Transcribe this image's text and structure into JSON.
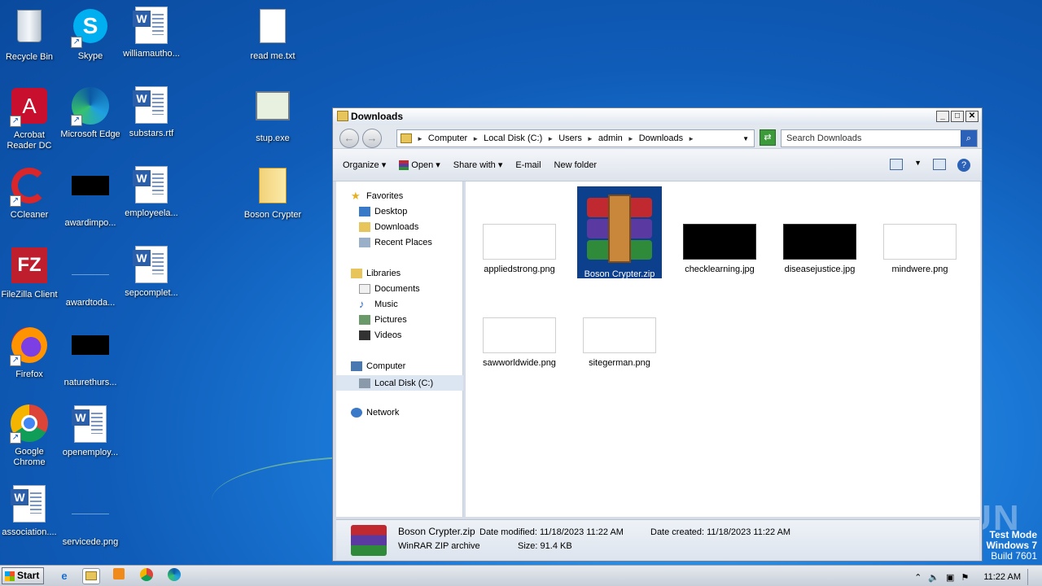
{
  "desktop": {
    "icons": [
      {
        "label": "Recycle Bin"
      },
      {
        "label": "Skype"
      },
      {
        "label": "williamautho..."
      },
      {
        "label": "read me.txt"
      },
      {
        "label": "Acrobat Reader DC"
      },
      {
        "label": "Microsoft Edge"
      },
      {
        "label": "substars.rtf"
      },
      {
        "label": "stup.exe"
      },
      {
        "label": "CCleaner"
      },
      {
        "label": "awardimpo..."
      },
      {
        "label": "employeela..."
      },
      {
        "label": "Boson Crypter"
      },
      {
        "label": "FileZilla Client"
      },
      {
        "label": "awardtoda..."
      },
      {
        "label": "sepcomplet..."
      },
      {
        "label": "Firefox"
      },
      {
        "label": "naturethurs..."
      },
      {
        "label": "Google Chrome"
      },
      {
        "label": "openemploy..."
      },
      {
        "label": "association...."
      },
      {
        "label": "servicede.png"
      }
    ]
  },
  "window": {
    "title": "Downloads",
    "address": {
      "crumbs": [
        "Computer",
        "Local Disk (C:)",
        "Users",
        "admin",
        "Downloads"
      ]
    },
    "search_placeholder": "Search Downloads",
    "toolbar": {
      "organize": "Organize",
      "open": "Open",
      "share_with": "Share with",
      "email": "E-mail",
      "new_folder": "New folder"
    },
    "nav": {
      "favorites": "Favorites",
      "desktop": "Desktop",
      "downloads": "Downloads",
      "recent_places": "Recent Places",
      "libraries": "Libraries",
      "documents": "Documents",
      "music": "Music",
      "pictures": "Pictures",
      "videos": "Videos",
      "computer": "Computer",
      "local_disk": "Local Disk (C:)",
      "network": "Network"
    },
    "files": [
      {
        "name": "appliedstrong.png"
      },
      {
        "name": "Boson Crypter.zip"
      },
      {
        "name": "checklearning.jpg"
      },
      {
        "name": "diseasejustice.jpg"
      },
      {
        "name": "mindwere.png"
      },
      {
        "name": "sawworldwide.png"
      },
      {
        "name": "sitegerman.png"
      }
    ],
    "details": {
      "name": "Boson Crypter.zip",
      "type": "WinRAR ZIP archive",
      "date_modified_label": "Date modified:",
      "date_modified": "11/18/2023 11:22 AM",
      "date_created_label": "Date created:",
      "date_created": "11/18/2023 11:22 AM",
      "size_label": "Size:",
      "size": "91.4 KB"
    }
  },
  "taskbar": {
    "start": "Start",
    "clock": "11:22 AM"
  },
  "watermark": {
    "line1": "Test Mode",
    "line2": "Windows 7",
    "line3": "Build 7601",
    "brand": "ANY RUN"
  },
  "colors": {
    "selection": "#0c3f8c",
    "desktop_blue": "#1b78d6"
  }
}
